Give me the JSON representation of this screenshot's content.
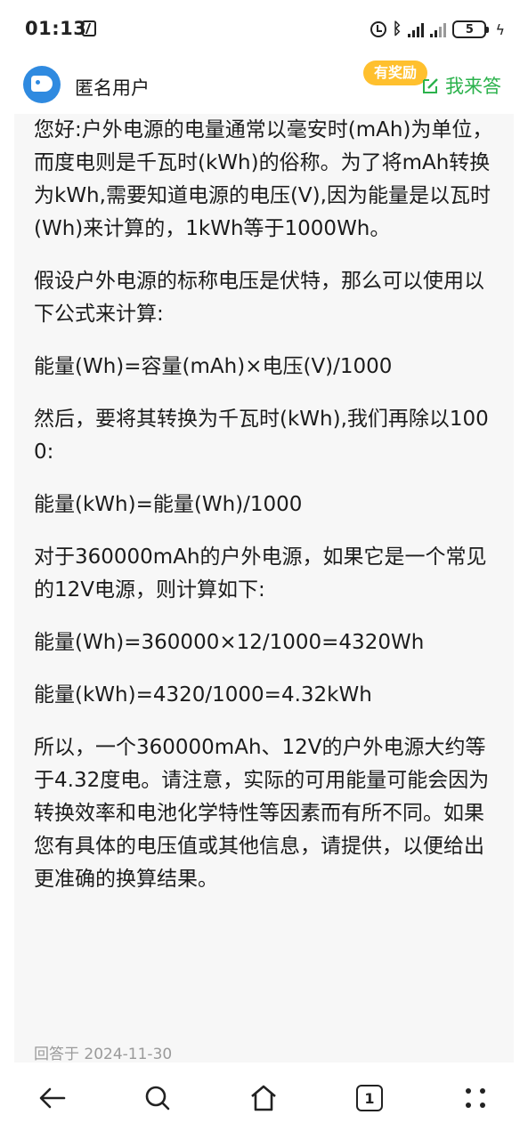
{
  "status_bar": {
    "time": "01:13",
    "nfc_icon": "nfc-icon",
    "alarm_icon": "alarm-icon",
    "bluetooth_icon": "bluetooth-icon",
    "signal_icon": "signal-icon",
    "battery_level": "5",
    "charging_icon": "charging-icon"
  },
  "header": {
    "user_name": "匿名用户",
    "reward_badge": "有奖励",
    "answer_button": "我来答",
    "accent_color": "#2bb24c",
    "badge_color": "#ffc02e",
    "avatar_color": "#2f8ae0"
  },
  "answer": {
    "paragraphs": [
      "您好:户外电源的电量通常以毫安时(mAh)为单位，而度电则是千瓦时(kWh)的俗称。为了将mAh转换为kWh,需要知道电源的电压(V),因为能量是以瓦时(Wh)来计算的，1kWh等于1000Wh。",
      "假设户外电源的标称电压是伏特，那么可以使用以下公式来计算:",
      "能量(Wh)=容量(mAh)×电压(V)/1000",
      "然后，要将其转换为千瓦时(kWh),我们再除以1000:",
      "能量(kWh)=能量(Wh)/1000",
      "对于360000mAh的户外电源，如果它是一个常见的12V电源，则计算如下:",
      "能量(Wh)=360000×12/1000=4320Wh",
      "能量(kWh)=4320/1000=4.32kWh",
      "所以，一个360000mAh、12V的户外电源大约等于4.32度电。请注意，实际的可用能量可能会因为转换效率和电池化学特性等因素而有所不同。如果您有具体的电压值或其他信息，请提供，以便给出更准确的换算结果。"
    ],
    "date": "回答于 2024-11-30"
  },
  "bottom_nav": {
    "back_icon": "back-arrow-icon",
    "search_icon": "search-icon",
    "home_icon": "home-icon",
    "tab_count": "1",
    "menu_icon": "more-dots-icon"
  }
}
